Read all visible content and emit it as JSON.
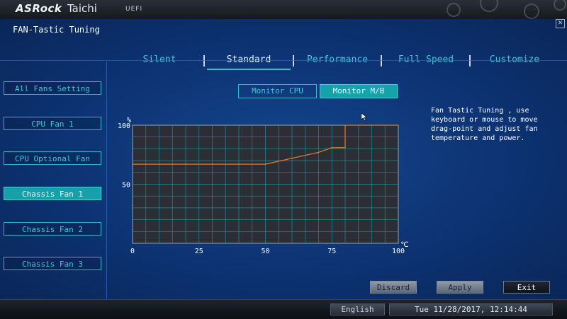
{
  "header": {
    "brand": "ASRock",
    "model": "Taichi",
    "firmware": "UEFI"
  },
  "window": {
    "title": "FAN-Tastic Tuning",
    "close_icon": "close-icon"
  },
  "tabs": [
    {
      "label": "Silent",
      "active": false
    },
    {
      "label": "Standard",
      "active": true
    },
    {
      "label": "Performance",
      "active": false
    },
    {
      "label": "Full Speed",
      "active": false
    },
    {
      "label": "Customize",
      "active": false
    }
  ],
  "fans": [
    {
      "label": "All Fans Setting",
      "active": false
    },
    {
      "label": "CPU Fan 1",
      "active": false
    },
    {
      "label": "CPU Optional Fan",
      "active": false
    },
    {
      "label": "Chassis Fan 1",
      "active": true
    },
    {
      "label": "Chassis Fan 2",
      "active": false
    },
    {
      "label": "Chassis Fan 3",
      "active": false
    }
  ],
  "monitor": {
    "cpu_label": "Monitor CPU",
    "mb_label": "Monitor M/B",
    "selected": "Monitor M/B"
  },
  "help_text": "Fan Tastic Tuning , use keyboard or mouse to move drag-point and adjust fan temperature and power.",
  "chart_data": {
    "type": "line",
    "ylabel": "%",
    "xlabel": "℃",
    "xlim": [
      0,
      100
    ],
    "ylim": [
      0,
      100
    ],
    "x_ticks": [
      0,
      25,
      50,
      75,
      100
    ],
    "y_ticks": [
      50,
      100
    ],
    "grid": true,
    "series": [
      {
        "color": "#e0782a",
        "x": [
          0,
          10,
          20,
          30,
          40,
          50,
          60,
          70,
          75,
          75,
          80,
          80,
          90,
          100
        ],
        "values": [
          67,
          67,
          67,
          67,
          67,
          67,
          72,
          77,
          81,
          81,
          81,
          100,
          100,
          100
        ]
      }
    ]
  },
  "actions": {
    "discard": "Discard",
    "apply": "Apply",
    "exit": "Exit"
  },
  "status": {
    "language": "English",
    "datetime": "Tue 11/28/2017, 12:14:44"
  },
  "colors": {
    "accent": "#2fc1cf",
    "curve": "#e0782a",
    "grid": "#1fa8b8"
  }
}
